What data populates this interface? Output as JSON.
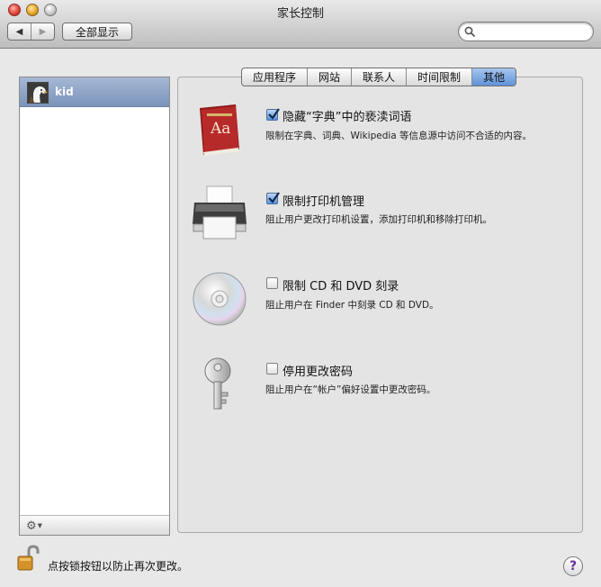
{
  "window": {
    "title": "家长控制"
  },
  "toolbar": {
    "back_glyph": "◀",
    "forward_glyph": "▶",
    "show_all_label": "全部显示",
    "search": {
      "value": "",
      "placeholder": ""
    }
  },
  "users": [
    {
      "name": "kid",
      "selected": true,
      "avatar": "eagle-avatar"
    }
  ],
  "tabs": [
    {
      "label": "应用程序",
      "active": false
    },
    {
      "label": "网站",
      "active": false
    },
    {
      "label": "联系人",
      "active": false
    },
    {
      "label": "时间限制",
      "active": false
    },
    {
      "label": "其他",
      "active": true
    }
  ],
  "options": [
    {
      "icon": "dictionary-icon",
      "checked": true,
      "label": "隐藏“字典”中的亵渎词语",
      "description": "限制在字典、词典、Wikipedia 等信息源中访问不合适的内容。"
    },
    {
      "icon": "printer-icon",
      "checked": true,
      "label": "限制打印机管理",
      "description": "阻止用户更改打印机设置，添加打印机和移除打印机。"
    },
    {
      "icon": "cd-dvd-icon",
      "checked": false,
      "label": "限制 CD 和 DVD 刻录",
      "description": "阻止用户在 Finder 中刻录 CD 和 DVD。"
    },
    {
      "icon": "key-icon",
      "checked": false,
      "label": "停用更改密码",
      "description": "阻止用户在“帐户”偏好设置中更改密码。"
    }
  ],
  "footer": {
    "lock_text": "点按锁按钮以防止再次更改。",
    "help_glyph": "?"
  },
  "colors": {
    "selection": "#7b93ba",
    "tab_active": "#5f93d9",
    "checkbox_checked": "#5b92dc"
  }
}
